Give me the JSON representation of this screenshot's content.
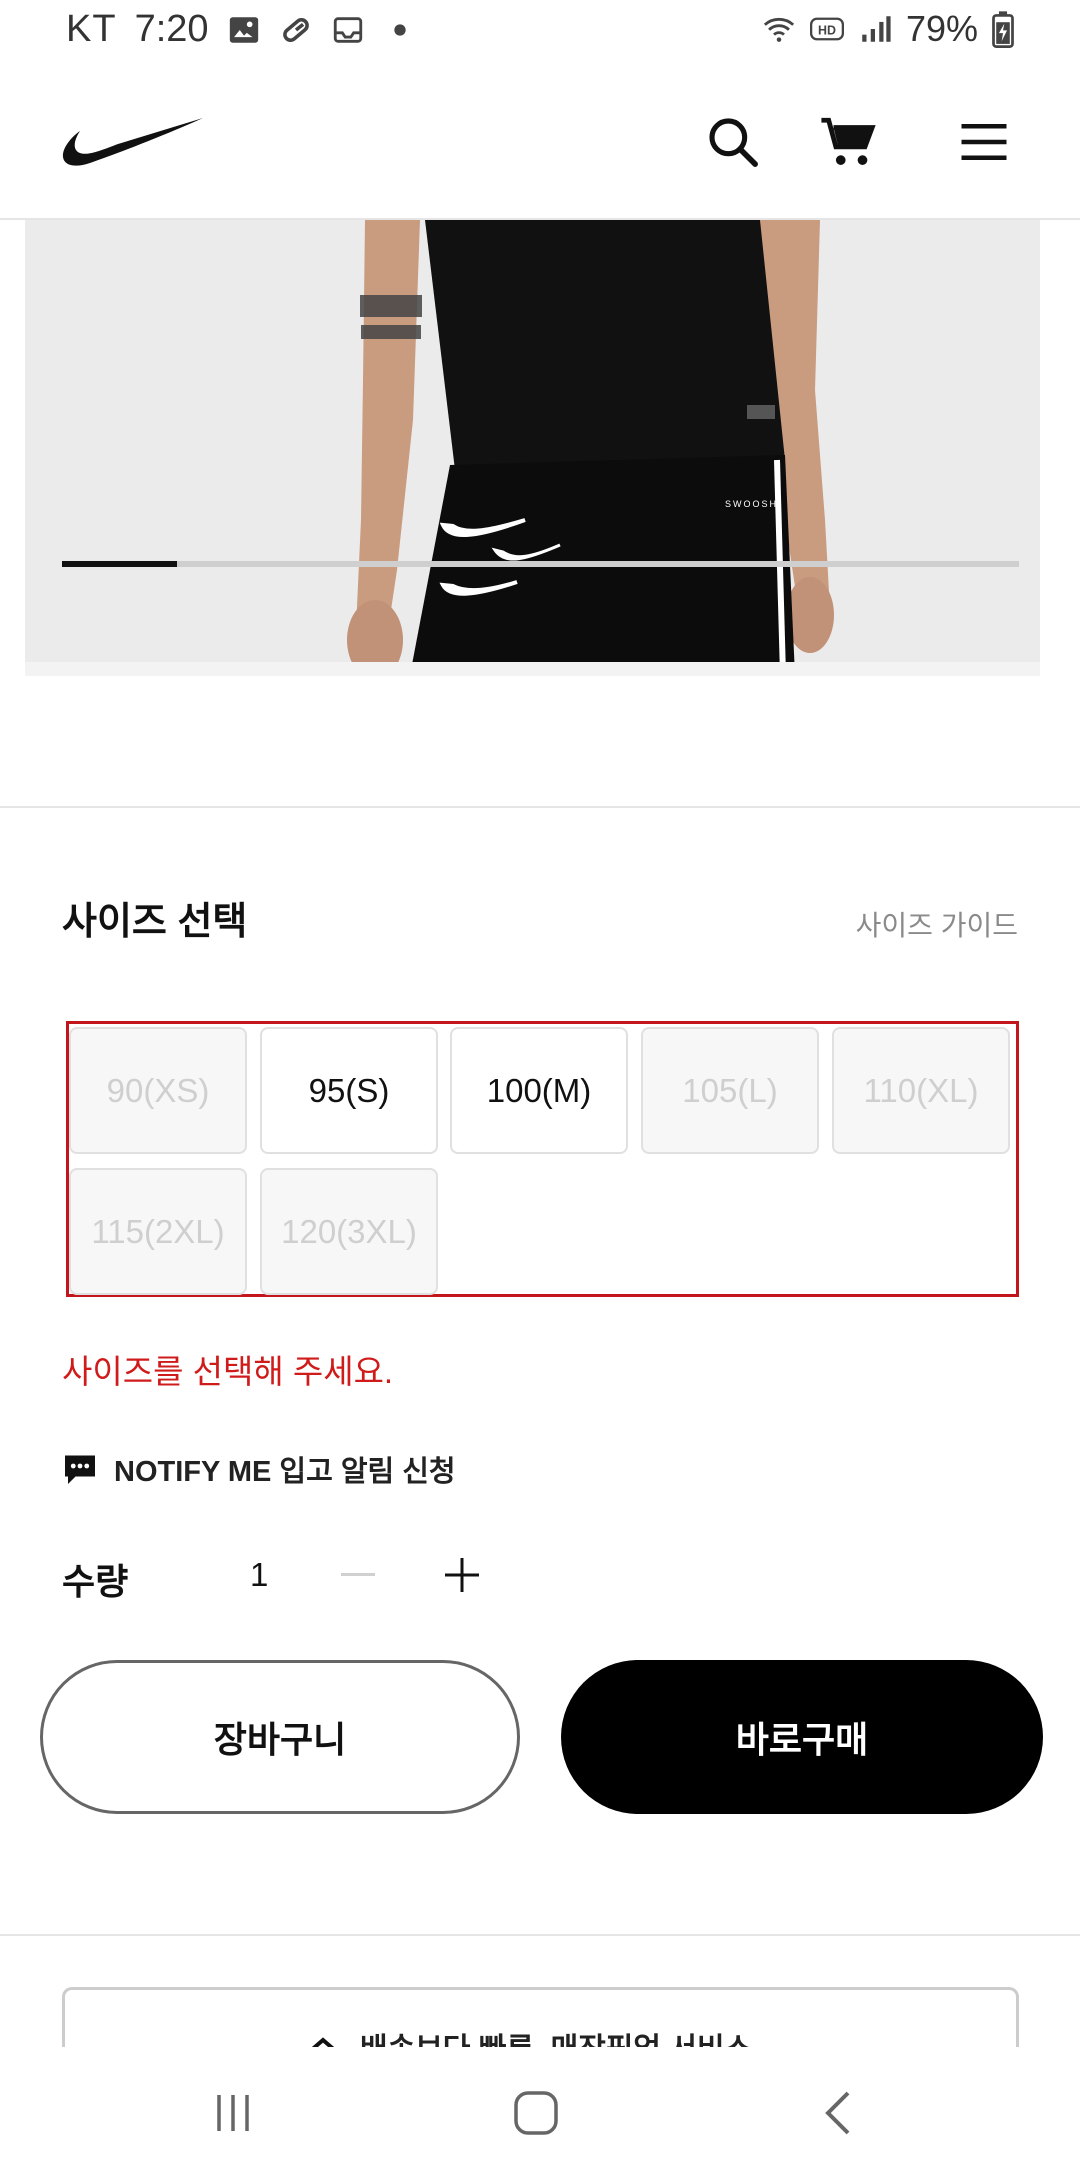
{
  "status_bar": {
    "carrier": "KT",
    "time": "7:20",
    "battery": "79%",
    "left_icons": [
      "gallery-icon",
      "pill-icon",
      "inbox-icon",
      "dot-icon"
    ],
    "right_icons": [
      "wifi-icon",
      "hd-icon",
      "signal-icon",
      "battery-icon"
    ]
  },
  "header": {
    "logo": "nike-swoosh-logo",
    "icons": [
      "search-icon",
      "cart-icon",
      "menu-icon"
    ]
  },
  "hero": {
    "carousel_progress": 0.12,
    "image": "model-black-tshirt-and-swoosh-pants"
  },
  "size_section": {
    "title": "사이즈 선택",
    "guide_link": "사이즈 가이드",
    "sizes": [
      {
        "label": "90(XS)",
        "available": false
      },
      {
        "label": "95(S)",
        "available": true
      },
      {
        "label": "100(M)",
        "available": true
      },
      {
        "label": "105(L)",
        "available": false
      },
      {
        "label": "110(XL)",
        "available": false
      },
      {
        "label": "115(2XL)",
        "available": false
      },
      {
        "label": "120(3XL)",
        "available": false
      }
    ],
    "error": "사이즈를 선택해 주세요."
  },
  "notify": {
    "label": "NOTIFY ME 입고 알림 신청"
  },
  "quantity": {
    "label": "수량",
    "value": "1"
  },
  "actions": {
    "cart": "장바구니",
    "buy": "바로구매"
  },
  "bottom_card": {
    "text": "배송보다 빠른, 매장픽업 서비스"
  },
  "colors": {
    "error": "#d01b1b",
    "primary": "#000000"
  }
}
